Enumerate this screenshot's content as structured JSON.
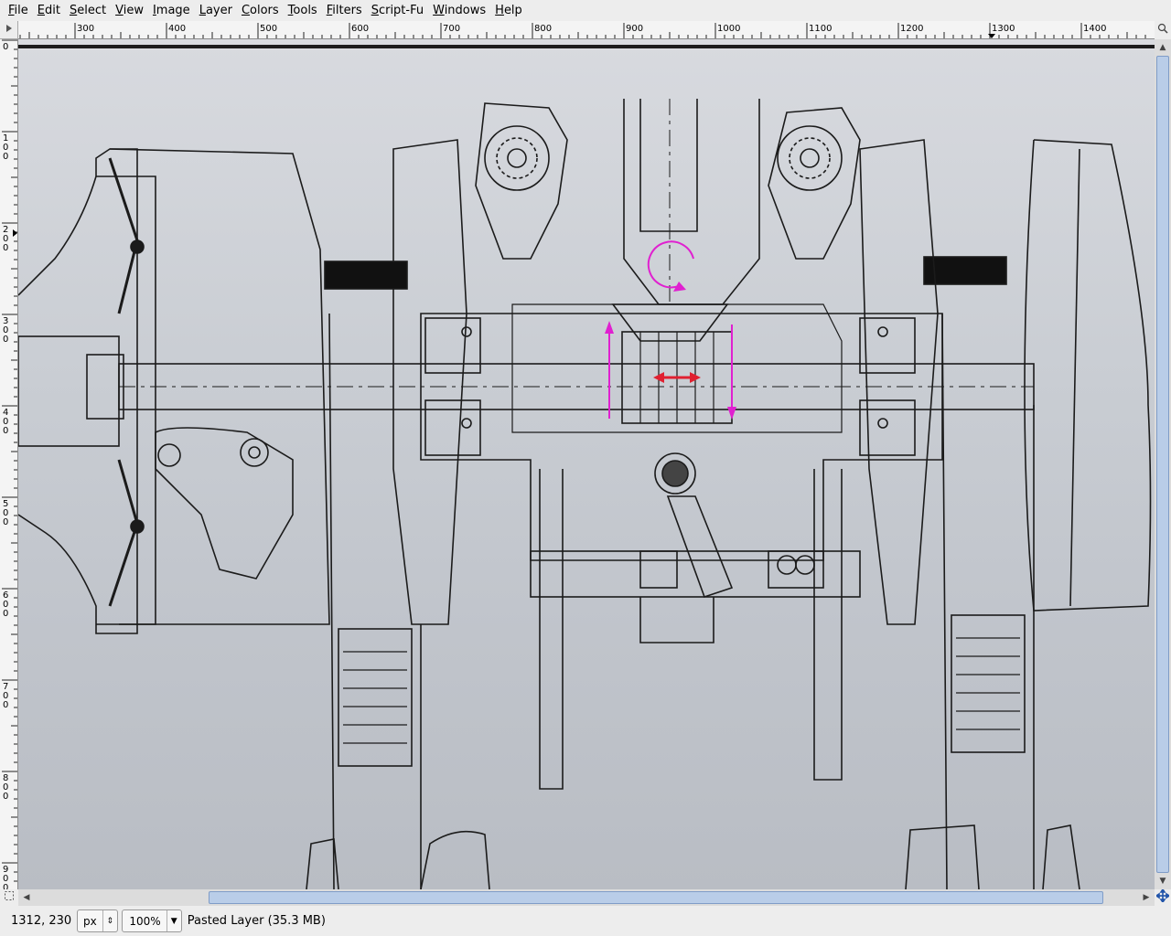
{
  "menubar": {
    "items": [
      "File",
      "Edit",
      "Select",
      "View",
      "Image",
      "Layer",
      "Colors",
      "Tools",
      "Filters",
      "Script-Fu",
      "Windows",
      "Help"
    ]
  },
  "ruler": {
    "h_labels": [
      "300",
      "400",
      "500",
      "600",
      "700",
      "800",
      "900",
      "1000",
      "1100",
      "1200",
      "1300",
      "1400"
    ],
    "v_labels": [
      "0",
      "100",
      "200",
      "300",
      "400",
      "500",
      "600",
      "700",
      "800",
      "900"
    ]
  },
  "status": {
    "coords": "1312, 230",
    "unit": "px",
    "zoom": "100%",
    "text": "Pasted Layer (35.3 MB)"
  },
  "icons": {
    "menu_corner": "triangle-menu-icon",
    "zoom_corner": "zoom-to-fit-icon",
    "quick_mask": "quick-mask-icon",
    "navigate": "navigate-icon"
  },
  "colors": {
    "annotation": "#e020d0",
    "arrow_red": "#e02030"
  }
}
